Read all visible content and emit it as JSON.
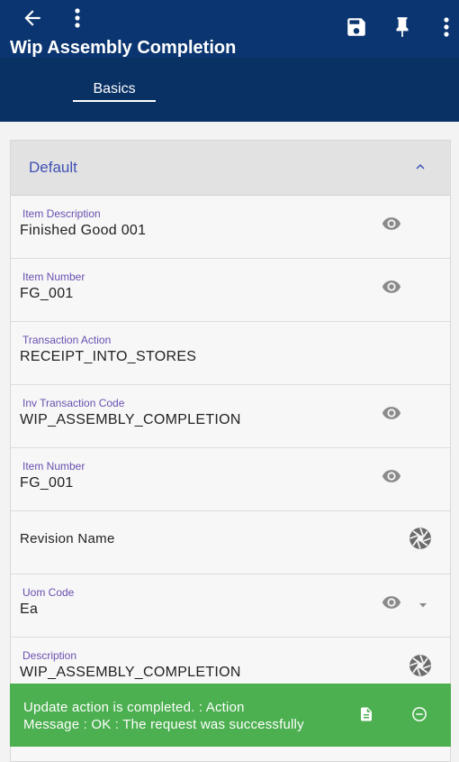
{
  "app": {
    "title": "Wip Assembly Completion",
    "colors": {
      "header": "#0b3570",
      "accent": "#3f51b5",
      "label": "#6a4fb0",
      "toast": "#4caf50"
    }
  },
  "toolbar": {
    "back_icon": "arrow-left-icon",
    "menu_icon": "more-vert-icon",
    "save_icon": "save-icon",
    "pin_icon": "pin-icon",
    "overflow_icon": "more-vert-icon"
  },
  "tabs": [
    {
      "label": "Basics",
      "active": true
    }
  ],
  "section": {
    "title": "Default",
    "expanded": true
  },
  "fields": [
    {
      "label": "Item Description",
      "value": "Finished Good 001",
      "action_icon": "eye-icon"
    },
    {
      "label": "Item Number",
      "value": "FG_001",
      "action_icon": "eye-icon"
    },
    {
      "label": "Transaction Action",
      "value": "RECEIPT_INTO_STORES"
    },
    {
      "label": "Inv Transaction Code",
      "value": "WIP_ASSEMBLY_COMPLETION",
      "action_icon": "eye-icon"
    },
    {
      "label": "Item Number",
      "value": "FG_001",
      "action_icon": "eye-icon"
    },
    {
      "label": "",
      "value": "Revision Name",
      "action_icon": "aperture-icon"
    },
    {
      "label": "Uom Code",
      "value": "Ea",
      "action_icon": "eye-icon",
      "dropdown_icon": "caret-down-icon"
    },
    {
      "label": "Description",
      "value": "WIP_ASSEMBLY_COMPLETION",
      "action_icon": "aperture-icon"
    }
  ],
  "toast": {
    "line1": "Update action is completed.  : Action",
    "line2": "Message : OK : The request was successfully",
    "doc_icon": "document-icon",
    "close_icon": "minus-circle-icon"
  }
}
